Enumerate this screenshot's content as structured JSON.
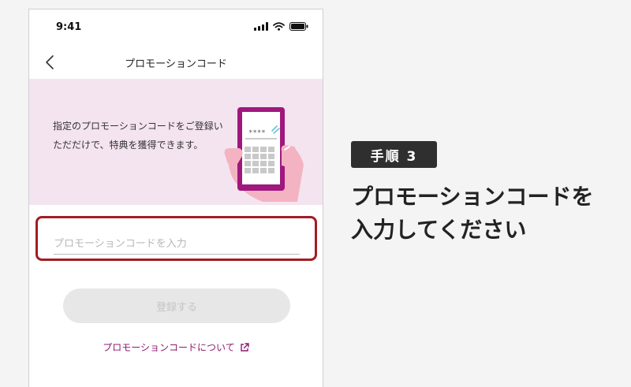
{
  "status_bar": {
    "time": "9:41",
    "icons": [
      "signal-icon",
      "wifi-icon",
      "battery-icon"
    ]
  },
  "nav": {
    "back_icon": "chevron-left-icon",
    "title": "プロモーションコード"
  },
  "banner": {
    "line1": "指定のプロモーションコードをご登録い",
    "line2": "ただだけで、特典を獲得できます。",
    "illustration": "phone-in-hand-icon"
  },
  "form": {
    "code_placeholder": "プロモーションコードを入力",
    "code_value": "",
    "register_label": "登録する"
  },
  "link": {
    "label": "プロモーションコードについて",
    "icon": "external-link-icon"
  },
  "instruction": {
    "step_label": "手順 3",
    "line1": "プロモーションコードを",
    "line2": "入力してください"
  },
  "colors": {
    "accent": "#a0177e",
    "highlight_frame": "#a11d24",
    "banner_bg": "#f4e4f0",
    "badge_bg": "#2f2f2f"
  }
}
